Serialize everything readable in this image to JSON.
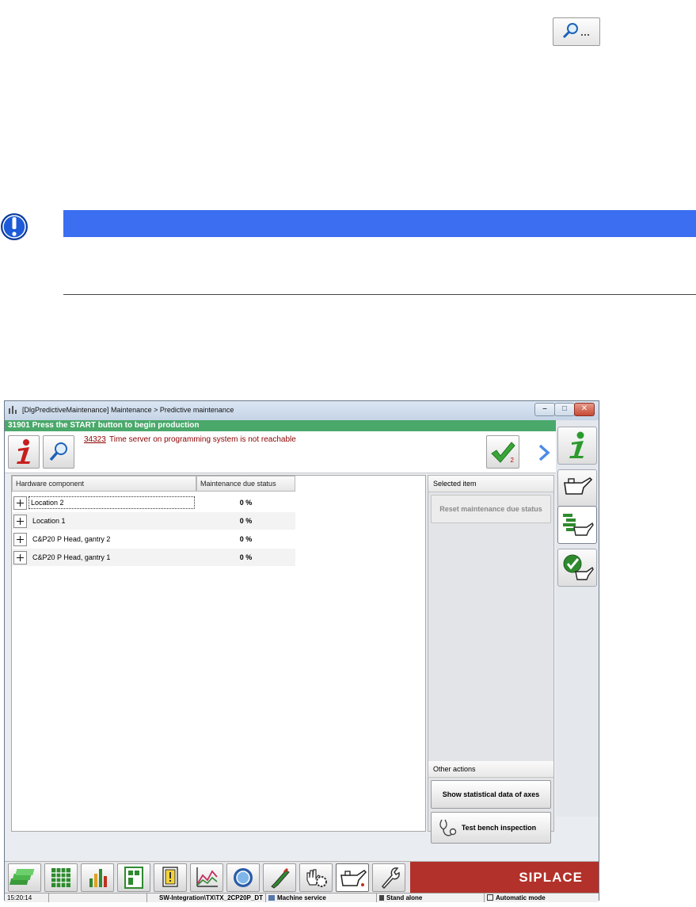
{
  "window": {
    "title": "[DlgPredictiveMaintenance] Maintenance > Predictive maintenance",
    "minimize": "–",
    "maximize": "□",
    "close": "✕"
  },
  "status_banner": "31901 Press the START button to begin production",
  "message": {
    "code": "34323",
    "text": "Time server on programming system is not reachable",
    "ack_count": "2"
  },
  "table": {
    "columns": [
      "Hardware component",
      "Maintenance due status"
    ],
    "rows": [
      {
        "component": "Location 2",
        "status": "0 %"
      },
      {
        "component": "Location 1",
        "status": "0 %"
      },
      {
        "component": "C&P20 P Head, gantry 2",
        "status": "0 %"
      },
      {
        "component": "C&P20 P Head, gantry 1",
        "status": "0 %"
      }
    ]
  },
  "actions": {
    "selected_header": "Selected item",
    "reset_label": "Reset maintenance due status",
    "other_header": "Other actions",
    "statistics_label": "Show statistical data of axes",
    "testbench_label": "Test bench inspection"
  },
  "brand": "SIPLACE",
  "status_bar": {
    "time": "15:20:14",
    "path": "SW-Integration\\TX\\TX_2CP20P_DT",
    "service": "Machine service",
    "standalone": "Stand alone",
    "mode": "Automatic mode"
  },
  "colors": {
    "notice_bar": "#3b6ef0",
    "banner": "#4aa86a",
    "brand": "#b2312a",
    "message": "#8b0000"
  }
}
